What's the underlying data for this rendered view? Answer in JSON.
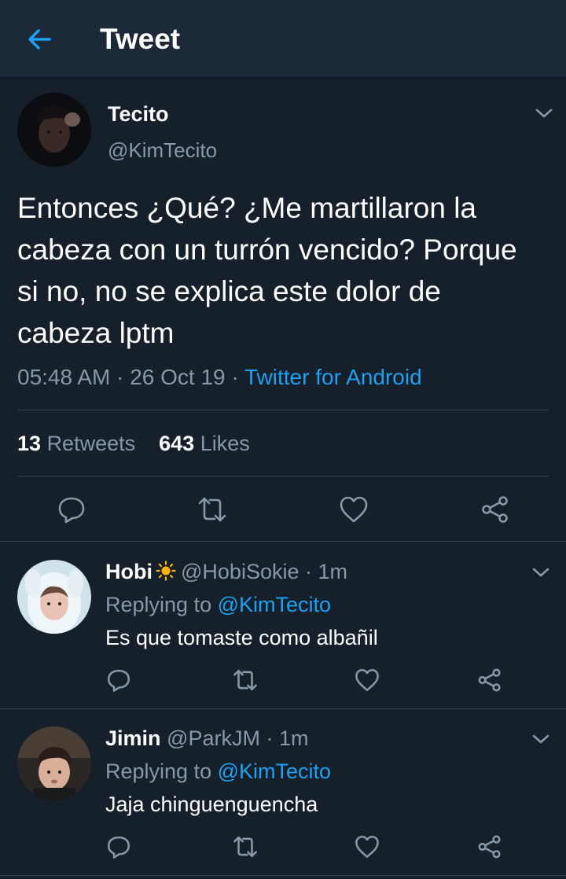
{
  "header": {
    "title": "Tweet"
  },
  "tweet": {
    "name": "Tecito",
    "handle": "@KimTecito",
    "text": "Entonces ¿Qué? ¿Me martillaron la cabeza con un turrón vencido? Porque si no, no se explica este dolor de cabeza lptm",
    "time": "05:48 AM",
    "date": "26 Oct 19",
    "source": "Twitter for Android",
    "retweets_count": "13",
    "retweets_label": "Retweets",
    "likes_count": "643",
    "likes_label": "Likes"
  },
  "replies": [
    {
      "name": "Hobi",
      "name_emoji": "sun-emoji",
      "handle": "@HobiSokie",
      "time": "1m",
      "replying_label": "Replying to",
      "replying_to": "@KimTecito",
      "text": "Es que tomaste como albañil"
    },
    {
      "name": "Jimin",
      "handle": "@ParkJM",
      "time": "1m",
      "replying_label": "Replying to",
      "replying_to": "@KimTecito",
      "text": "Jaja chinguenguencha"
    }
  ],
  "icons": [
    "back-arrow-icon",
    "chevron-down-icon",
    "reply-icon",
    "retweet-icon",
    "like-icon",
    "share-icon"
  ],
  "colors": {
    "background": "#15202b",
    "header": "#1c2938",
    "accent": "#1da1f2",
    "muted": "#8899a6",
    "divider": "#38444d"
  }
}
